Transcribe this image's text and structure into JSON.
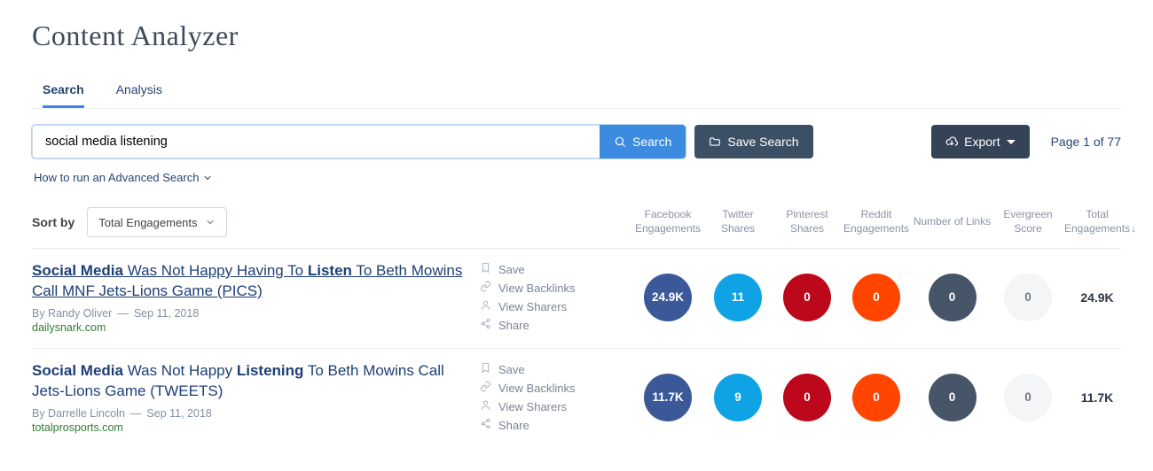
{
  "page": {
    "title": "Content Analyzer",
    "pagination": "Page 1 of 77"
  },
  "tabs": {
    "search": "Search",
    "analysis": "Analysis"
  },
  "search": {
    "value": "social media listening",
    "button": "Search",
    "save": "Save Search",
    "export": "Export",
    "advanced": "How to run an Advanced Search"
  },
  "sort": {
    "label": "Sort by",
    "selected": "Total Engagements"
  },
  "headers": {
    "actions": "",
    "fb": "Facebook Engagements",
    "tw": "Twitter Shares",
    "pin": "Pinterest Shares",
    "rd": "Reddit Engagements",
    "links": "Number of Links",
    "evergreen": "Evergreen Score",
    "total": "Total Engagements"
  },
  "chart_data": {
    "type": "table",
    "columns": [
      "Title",
      "Author",
      "Date",
      "Domain",
      "Facebook Engagements",
      "Twitter Shares",
      "Pinterest Shares",
      "Reddit Engagements",
      "Number of Links",
      "Evergreen Score",
      "Total Engagements"
    ],
    "rows": [
      [
        "Social Media Was Not Happy Having To Listen To Beth Mowins Call MNF Jets-Lions Game (PICS)",
        "Randy Oliver",
        "Sep 11, 2018",
        "dailysnark.com",
        "24.9K",
        11,
        0,
        0,
        0,
        0,
        "24.9K"
      ],
      [
        "Social Media Was Not Happy Listening To Beth Mowins Call Jets-Lions Game (TWEETS)",
        "Darrelle Lincoln",
        "Sep 11, 2018",
        "totalprosports.com",
        "11.7K",
        9,
        0,
        0,
        0,
        0,
        "11.7K"
      ]
    ]
  },
  "results": [
    {
      "title_html": "<b>Social Media</b> Was Not Happy Having To <b>Listen</b> To Beth Mowins Call MNF Jets-Lions Game (PICS)",
      "author": "By Randy Oliver",
      "date": "Sep 11, 2018",
      "domain": "dailysnark.com",
      "fb": "24.9K",
      "tw": "11",
      "pin": "0",
      "rd": "0",
      "links": "0",
      "evergreen": "0",
      "total": "24.9K",
      "underline": true
    },
    {
      "title_html": "<b>Social Media</b> Was Not Happy <b>Listening</b> To Beth Mowins Call Jets-Lions Game (TWEETS)",
      "author": "By Darrelle Lincoln",
      "date": "Sep 11, 2018",
      "domain": "totalprosports.com",
      "fb": "11.7K",
      "tw": "9",
      "pin": "0",
      "rd": "0",
      "links": "0",
      "evergreen": "0",
      "total": "11.7K",
      "underline": false
    }
  ],
  "actions": {
    "save": "Save",
    "backlinks": "View Backlinks",
    "sharers": "View Sharers",
    "share": "Share"
  }
}
